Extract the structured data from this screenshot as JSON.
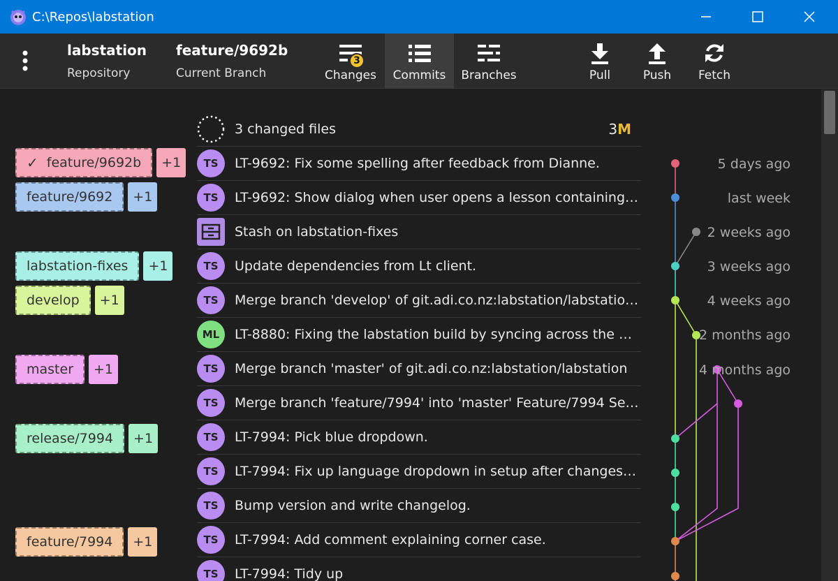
{
  "window": {
    "title": "C:\\Repos\\labstation"
  },
  "toolbar": {
    "repo_name": "labstation",
    "repo_sub": "Repository",
    "branch_name": "feature/9692b",
    "branch_sub": "Current Branch",
    "changes_label": "Changes",
    "changes_count": "3",
    "commits_label": "Commits",
    "branches_label": "Branches",
    "pull_label": "Pull",
    "push_label": "Push",
    "fetch_label": "Fetch"
  },
  "colors": {
    "titlebar": "#0078d7",
    "ts": "#b88cf0",
    "ml": "#7ee081",
    "line_red": "#e06377",
    "line_blue": "#4a90d9",
    "line_teal": "#4dd0c4",
    "line_lime": "#b6e653",
    "line_magenta": "#d65ce0",
    "line_green": "#4ede9f",
    "line_orange": "#e0894a",
    "line_gray": "#888888"
  },
  "branches": [
    {
      "name": "feature/9692b",
      "count": "+1",
      "checked": "✓",
      "bg": "#f7a8b8"
    },
    {
      "name": "feature/9692",
      "count": "+1",
      "bg": "#a8c8f0"
    },
    {
      "name": "labstation-fixes",
      "count": "+1",
      "bg": "#a8f0e6"
    },
    {
      "name": "develop",
      "count": "+1",
      "bg": "#d8f59c"
    },
    {
      "name": "master",
      "count": "+1",
      "bg": "#f0a8f0"
    },
    {
      "name": "release/7994",
      "count": "+1",
      "bg": "#a8f0c8"
    },
    {
      "name": "feature/7994",
      "count": "+1",
      "bg": "#f5c8a0"
    }
  ],
  "changes_row": {
    "text": "3 changed files",
    "count": "3",
    "marker": "M"
  },
  "commits": [
    {
      "avatar": "TS",
      "message": "LT-9692: Fix some spelling after feedback from Dianne.",
      "time": "5 days ago"
    },
    {
      "avatar": "TS",
      "message": "LT-9692: Show dialog when user opens a lesson containing …",
      "time": "last week"
    },
    {
      "avatar": "stash",
      "message": "Stash on labstation-fixes",
      "time": "2 weeks ago"
    },
    {
      "avatar": "TS",
      "message": "Update dependencies from Lt client.",
      "time": "3 weeks ago"
    },
    {
      "avatar": "TS",
      "message": "Merge branch 'develop' of git.adi.co.nz:labstation/labstation…",
      "time": "4 weeks ago"
    },
    {
      "avatar": "ML",
      "message": "LT-8880: Fixing the labstation build by syncing across the de…",
      "time": "2 months ago"
    },
    {
      "avatar": "TS",
      "message": "Merge branch 'master' of git.adi.co.nz:labstation/labstation",
      "time": "4 months ago"
    },
    {
      "avatar": "TS",
      "message": "Merge branch 'feature/7994' into 'master' Feature/7994 See…",
      "time": ""
    },
    {
      "avatar": "TS",
      "message": "LT-7994: Pick blue dropdown.",
      "time": ""
    },
    {
      "avatar": "TS",
      "message": "LT-7994: Fix up language dropdown in setup after changes t…",
      "time": ""
    },
    {
      "avatar": "TS",
      "message": "Bump version and write changelog.",
      "time": ""
    },
    {
      "avatar": "TS",
      "message": "LT-7994: Add comment explaining corner case.",
      "time": ""
    },
    {
      "avatar": "TS",
      "message": "LT-7994: Tidy up",
      "time": ""
    }
  ]
}
